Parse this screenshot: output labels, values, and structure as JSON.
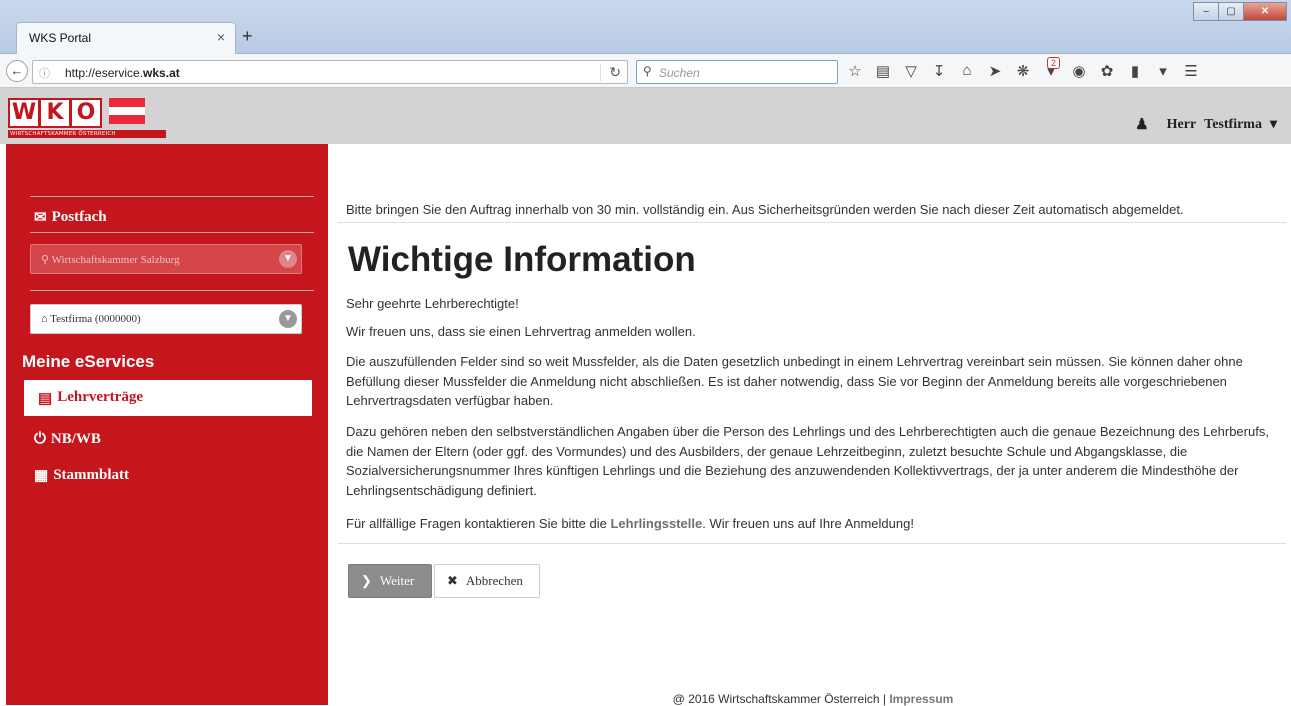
{
  "browser": {
    "tab_title": "WKS Portal",
    "tab_close": "×",
    "new_tab": "+",
    "url_prefix": "http://eservice.",
    "url_domain": "wks.at",
    "search_placeholder": "Suchen",
    "badge_count": "2",
    "window_buttons": [
      "–",
      "▢",
      "✕"
    ]
  },
  "header": {
    "logo_letters": [
      "W",
      "K",
      "O"
    ],
    "logo_subtitle": "WIRTSCHAFTSKAMMER ÖSTERREICH",
    "flag_colors": [
      "#ed2939",
      "#ffffff",
      "#ed2939"
    ],
    "user_salutation": "Herr",
    "user_name": "Testfirma"
  },
  "sidebar": {
    "postfach": "Postfach",
    "chamber_select": "Wirtschaftskammer   Salzburg",
    "company_select": "Testfirma   (0000000)",
    "services_title": "Meine eServices",
    "items": [
      {
        "label": "Lehrverträge",
        "icon": "list-icon",
        "active": true
      },
      {
        "label": "NB/WB",
        "icon": "power-icon",
        "active": false
      },
      {
        "label": "Stammblatt",
        "icon": "document-icon",
        "active": false
      }
    ]
  },
  "main": {
    "notice": "Bitte bringen Sie den Auftrag innerhalb von 30 min. vollständig ein. Aus Sicherheitsgründen werden Sie nach dieser Zeit automatisch abgemeldet.",
    "heading": "Wichtige Information",
    "greeting": "Sehr geehrte Lehrberechtigte!",
    "p1": "Wir freuen uns, dass sie einen Lehrvertrag anmelden wollen.",
    "p2": "Die auszufüllenden Felder sind so weit Mussfelder, als die Daten gesetzlich unbedingt in einem Lehrvertrag vereinbart sein müssen. Sie können daher ohne Befüllung dieser Mussfelder die Anmeldung nicht abschließen. Es ist daher notwendig, dass Sie vor Beginn der Anmeldung bereits alle vorgeschriebenen Lehrvertragsdaten verfügbar haben.",
    "p3": "Dazu gehören neben den selbstverständlichen Angaben über die Person des Lehrlings und des Lehrberechtigten auch die genaue Bezeichnung des Lehrberufs, die Namen der Eltern (oder ggf. des Vormundes) und des Ausbilders, der genaue Lehrzeitbeginn, zuletzt besuchte Schule und Abgangsklasse, die Sozialversicherungsnummer Ihres künftigen Lehrlings und die Beziehung des anzuwendenden Kollektivvertrags, der ja unter anderem die Mindesthöhe der Lehrlingsentschädigung definiert.",
    "p4_before": "Für allfällige Fragen kontaktieren Sie bitte die ",
    "p4_link": "Lehrlingsstelle",
    "p4_after": ". Wir freuen uns auf Ihre Anmeldung!",
    "btn_next": "Weiter",
    "btn_cancel": "Abbrechen"
  },
  "footer": {
    "copyright": "@ 2016 Wirtschaftskammer Österreich | ",
    "impressum": "Impressum"
  }
}
